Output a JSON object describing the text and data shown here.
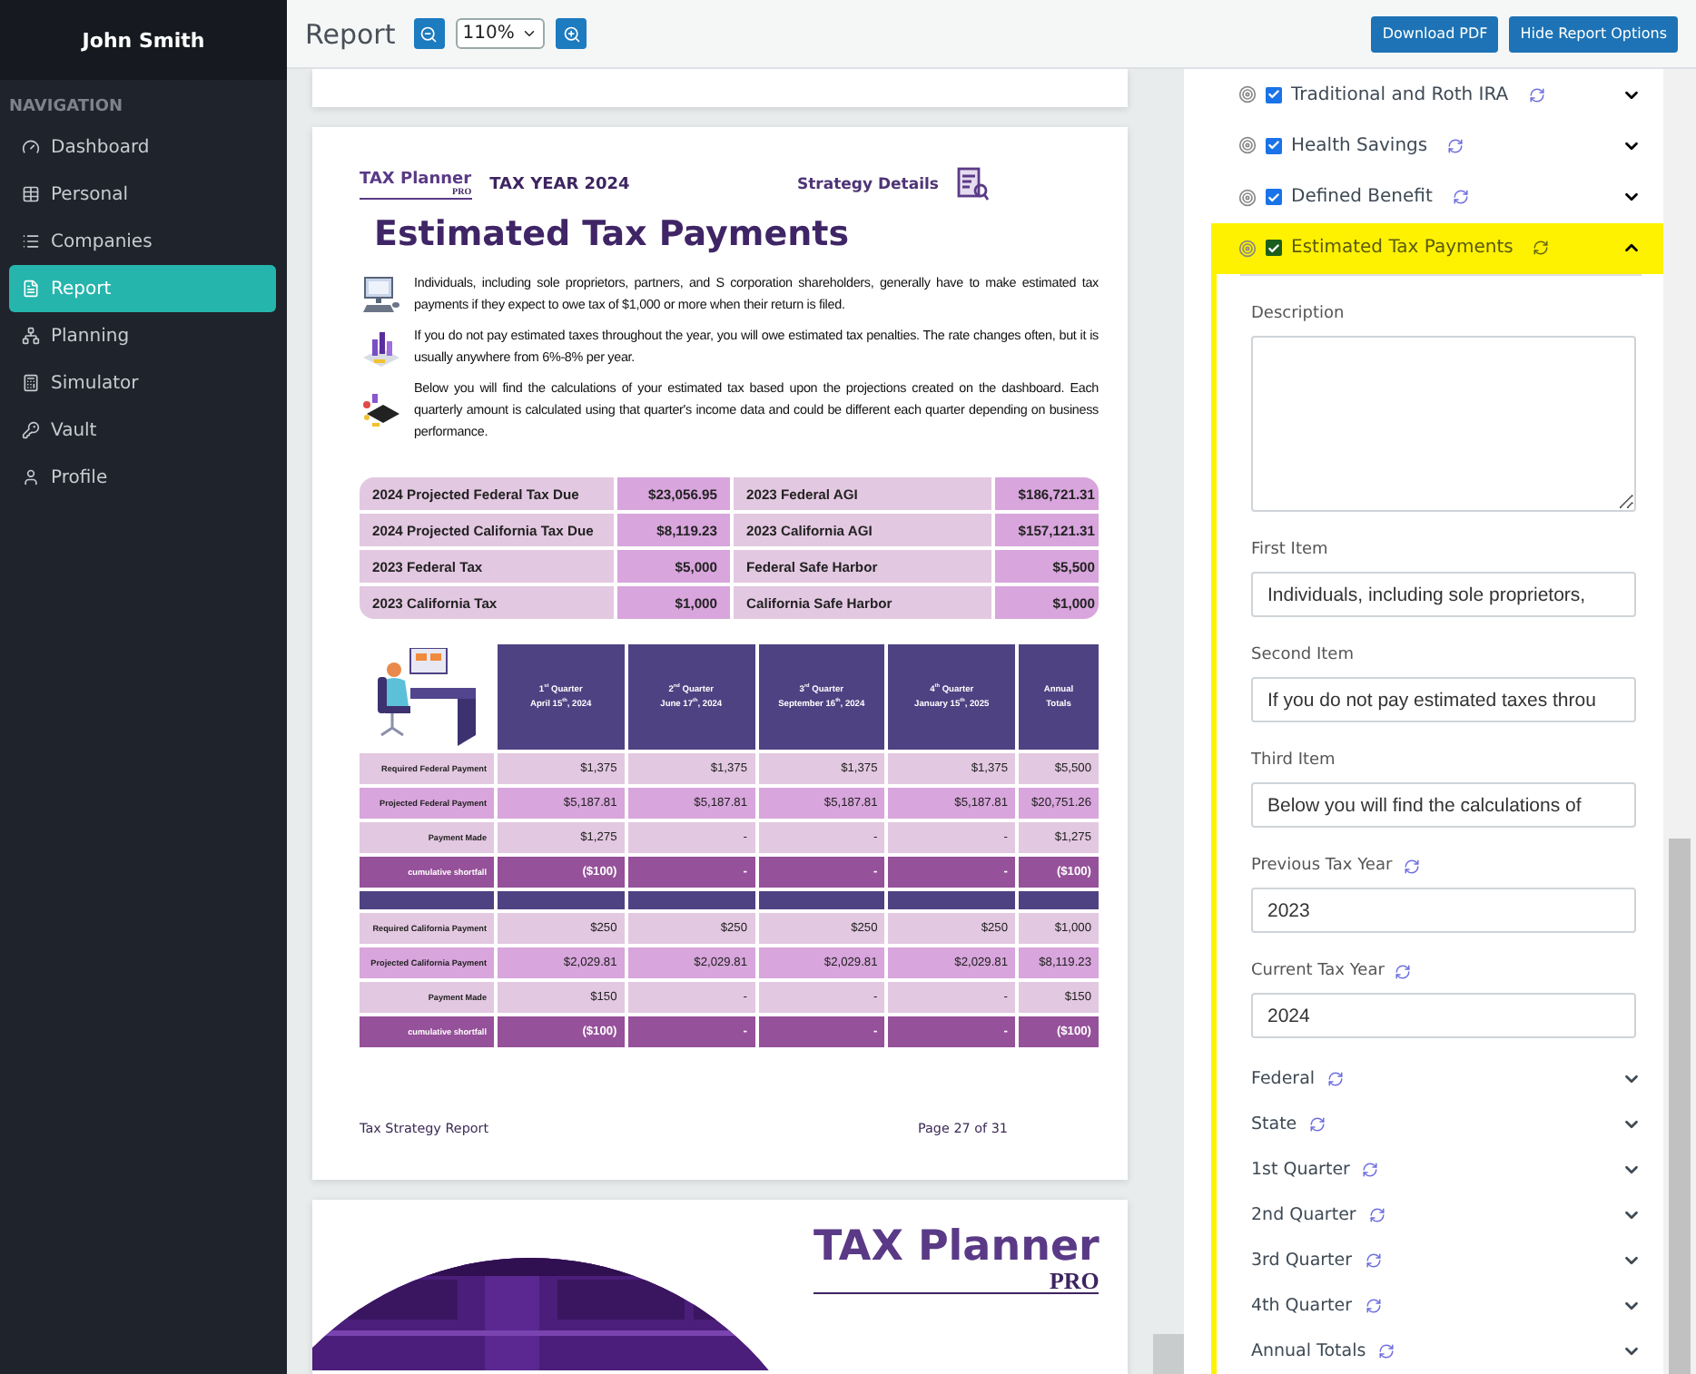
{
  "sidebar": {
    "user": "John Smith",
    "section": "NAVIGATION",
    "items": [
      {
        "label": "Dashboard",
        "selected": false
      },
      {
        "label": "Personal",
        "selected": false
      },
      {
        "label": "Companies",
        "selected": false
      },
      {
        "label": "Report",
        "selected": true
      },
      {
        "label": "Planning",
        "selected": false
      },
      {
        "label": "Simulator",
        "selected": false
      },
      {
        "label": "Vault",
        "selected": false
      },
      {
        "label": "Profile",
        "selected": false
      }
    ]
  },
  "toolbar": {
    "title": "Report",
    "zoom": "110%",
    "buttons": [
      "Download PDF",
      "Hide Report Options"
    ]
  },
  "report_page": {
    "brand": "TAX Planner",
    "brand_sub": "PRO",
    "tax_year": "TAX YEAR 2024",
    "section": "Strategy Details",
    "title": "Estimated Tax Payments",
    "paragraphs": [
      "Individuals, including sole proprietors, partners, and S corporation shareholders, generally have to make estimated tax payments if they expect to owe tax of $1,000 or more when their return is filed.",
      "If you do not pay estimated taxes throughout the year, you will owe estimated tax penalties. The rate changes often, but it is usually anywhere from 6%-8% per year.",
      "Below you will find the calculations of your estimated tax based upon the projections created on the dashboard.  Each quarterly amount is calculated using that quarter's income data and could be different each quarter depending on business performance."
    ],
    "summary": [
      [
        "2024 Projected Federal Tax Due",
        "$23,056.95",
        "2023 Federal AGI",
        "$186,721.31"
      ],
      [
        "2024 Projected California Tax Due",
        "$8,119.23",
        "2023 California AGI",
        "$157,121.31"
      ],
      [
        "2023 Federal Tax",
        "$5,000",
        "Federal Safe Harbor",
        "$5,500"
      ],
      [
        "2023 California Tax",
        "$1,000",
        "California Safe Harbor",
        "$1,000"
      ]
    ],
    "columns": [
      {
        "title": "1$^{st}$ Quarter",
        "date": "April 15$^{th}$, 2024"
      },
      {
        "title": "2$^{nd}$ Quarter",
        "date": "June 17$^{th}$, 2024"
      },
      {
        "title": "3$^{rd}$ Quarter",
        "date": "September 16$^{th}$, 2024"
      },
      {
        "title": "4$^{th}$ Quarter",
        "date": "January 15$^{th}$, 2025"
      },
      {
        "title": "Annual",
        "date": "Totals"
      }
    ],
    "federal_rows": [
      {
        "kind": "light",
        "label": "Required Federal Payment",
        "values": [
          "$1,375",
          "$1,375",
          "$1,375",
          "$1,375",
          "$5,500"
        ]
      },
      {
        "kind": "medium",
        "label": "Projected Federal Payment",
        "values": [
          "$5,187.81",
          "$5,187.81",
          "$5,187.81",
          "$5,187.81",
          "$20,751.26"
        ]
      },
      {
        "kind": "light",
        "label": "Payment Made",
        "values": [
          "$1,275",
          "-",
          "-",
          "-",
          "$1,275"
        ]
      },
      {
        "kind": "total",
        "label": "cumulative shortfall",
        "values": [
          "($100)",
          "-",
          "-",
          "-",
          "($100)"
        ]
      }
    ],
    "california_rows": [
      {
        "kind": "light",
        "label": "Required California Payment",
        "values": [
          "$250",
          "$250",
          "$250",
          "$250",
          "$1,000"
        ]
      },
      {
        "kind": "medium",
        "label": "Projected California Payment",
        "values": [
          "$2,029.81",
          "$2,029.81",
          "$2,029.81",
          "$2,029.81",
          "$8,119.23"
        ]
      },
      {
        "kind": "light",
        "label": "Payment Made",
        "values": [
          "$150",
          "-",
          "-",
          "-",
          "$150"
        ]
      },
      {
        "kind": "total",
        "label": "cumulative shortfall",
        "values": [
          "($100)",
          "-",
          "-",
          "-",
          "($100)"
        ]
      }
    ],
    "footer": {
      "left": "Tax Strategy Report",
      "right": "Page 27 of 31"
    }
  },
  "next_page": {
    "brand": "TAX Planner",
    "brand_sub": "PRO",
    "kind": "picture"
  },
  "options": {
    "strategies": [
      {
        "label": "Traditional and Roth IRA",
        "checked": true,
        "selected": false,
        "expanded": false
      },
      {
        "label": "Health Savings",
        "checked": true,
        "selected": false,
        "expanded": false
      },
      {
        "label": "Defined Benefit",
        "checked": true,
        "selected": false,
        "expanded": false
      },
      {
        "label": "Estimated Tax Payments",
        "checked": true,
        "selected": true,
        "expanded": true
      }
    ],
    "fields": [
      {
        "kind": "textarea",
        "label": "Description",
        "refresh": false
      },
      {
        "kind": "text",
        "label": "First Item",
        "value": "Individuals, including sole proprietors,",
        "refresh": false
      },
      {
        "kind": "text",
        "label": "Second Item",
        "value": "If you do not pay estimated taxes throu",
        "refresh": false
      },
      {
        "kind": "text",
        "label": "Third Item",
        "value": "Below you will find the calculations of",
        "refresh": false
      },
      {
        "kind": "text",
        "label": "Previous Tax Year",
        "value": "2023",
        "refresh": true
      },
      {
        "kind": "text",
        "label": "Current Tax Year",
        "value": "2024",
        "refresh": true
      }
    ],
    "sections": [
      "Federal",
      "State",
      "1st Quarter",
      "2nd Quarter",
      "3rd Quarter",
      "4th Quarter",
      "Annual Totals"
    ]
  }
}
